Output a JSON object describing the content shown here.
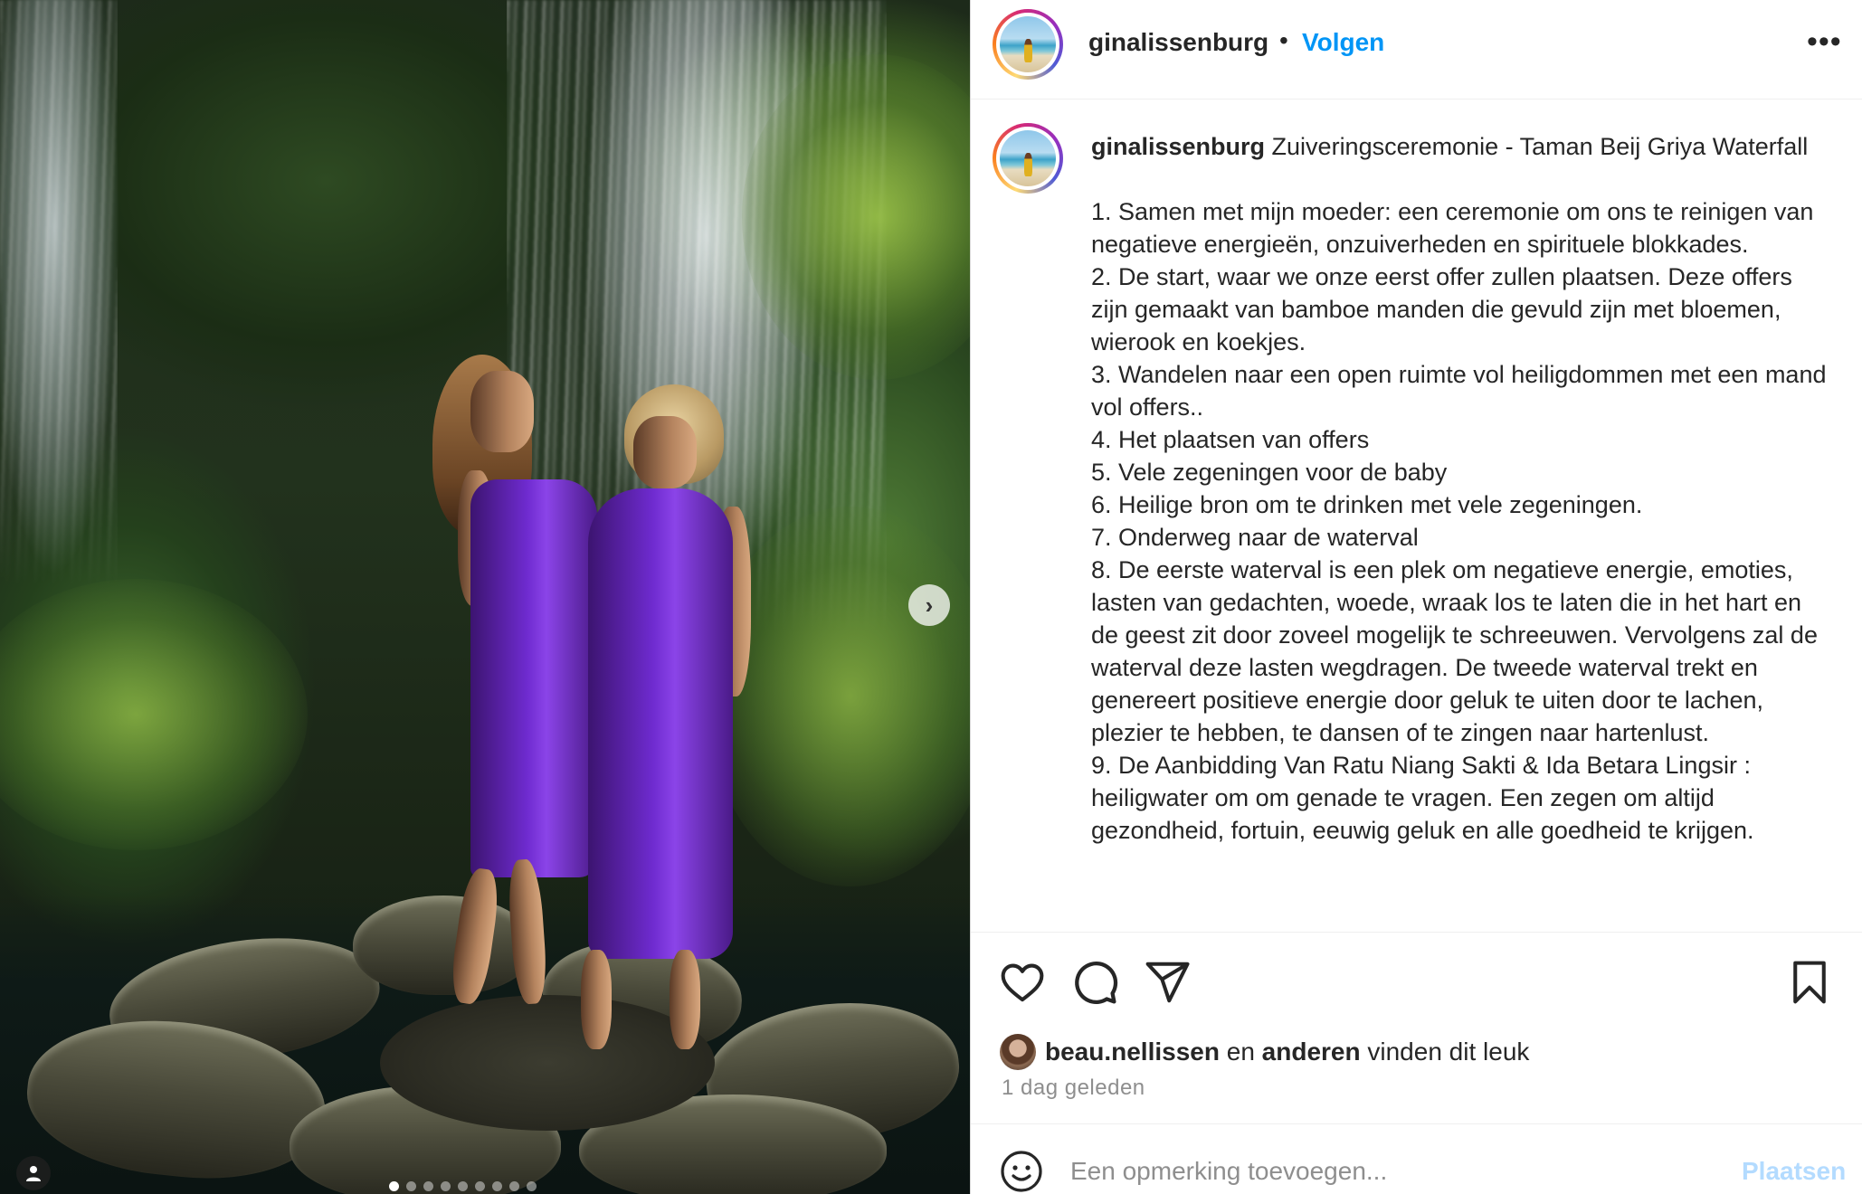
{
  "post": {
    "username": "ginalissenburg",
    "follow_label": "Volgen",
    "separator": "•",
    "more_label": "•••"
  },
  "caption": {
    "username": "ginalissenburg",
    "text": " Zuiveringsceremonie - Taman Beij Griya Waterfall\n\n1. Samen met mijn moeder: een ceremonie om ons te reinigen van negatieve energieën, onzuiverheden en spirituele blokkades.\n2. De start, waar we onze eerst offer zullen plaatsen. Deze offers zijn gemaakt van bamboe manden die gevuld zijn met bloemen, wierook en koekjes.\n3. Wandelen naar een open ruimte vol heiligdommen met een mand vol offers..\n4. Het plaatsen van offers\n5. Vele zegeningen voor de baby\n6. Heilige bron om te drinken met vele zegeningen.\n7. Onderweg naar de waterval\n8. De eerste waterval is een plek om negatieve energie, emoties, lasten van gedachten, woede, wraak los te laten die in het hart en de geest zit door zoveel mogelijk te schreeuwen. Vervolgens zal de waterval deze lasten wegdragen. De tweede waterval trekt en genereert positieve energie door geluk te uiten door te lachen, plezier te hebben, te dansen of te zingen naar hartenlust.\n9. De Aanbidding Van Ratu Niang Sakti & Ida Betara Lingsir : heiligwater om om genade te vragen. Een zegen om altijd gezondheid, fortuin, eeuwig geluk en alle goedheid te krijgen."
  },
  "likes": {
    "user": "beau.nellissen",
    "connector": " en ",
    "others": "anderen",
    "suffix": " vinden dit leuk"
  },
  "timestamp": "1 dag geleden",
  "comment": {
    "placeholder": "Een opmerking toevoegen...",
    "post_label": "Plaatsen"
  },
  "carousel": {
    "next_label": "›",
    "slide_count": 9,
    "active_index": 0
  },
  "colors": {
    "accent": "#0095f6",
    "post_disabled": "#b3dbff",
    "muted": "#8e8e8e",
    "dress": "#6f2bd0"
  },
  "icons": [
    "heart-icon",
    "comment-icon",
    "share-icon",
    "bookmark-icon",
    "emoji-icon",
    "person-tag-icon",
    "chevron-right-icon",
    "more-icon"
  ]
}
